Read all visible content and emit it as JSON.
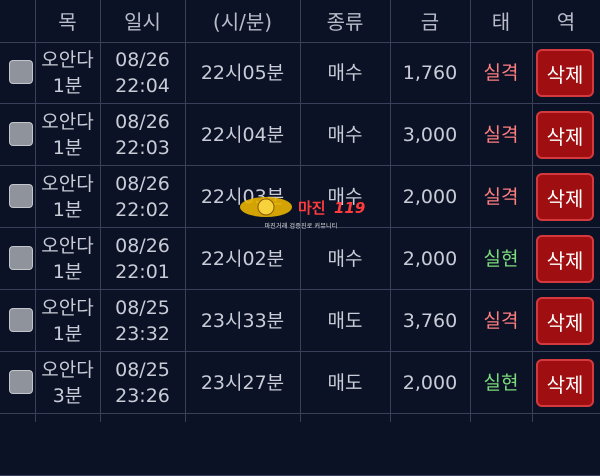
{
  "header": {
    "col1": [
      "",
      "목"
    ],
    "col2": [
      "",
      "일시"
    ],
    "col3": [
      "",
      "(시/분)"
    ],
    "col4": [
      "",
      "종류"
    ],
    "col5": [
      "",
      "금"
    ],
    "col6": [
      "",
      "태"
    ],
    "col7": [
      "",
      "역"
    ]
  },
  "rows": [
    {
      "name_l1": "오안다",
      "name_l2": "1분",
      "date": "08/26",
      "time": "22:04",
      "target": "22시05분",
      "kind": "매수",
      "amount": "1,760",
      "result": "실격",
      "result_status": "fail",
      "delete": "삭제"
    },
    {
      "name_l1": "오안다",
      "name_l2": "1분",
      "date": "08/26",
      "time": "22:03",
      "target": "22시04분",
      "kind": "매수",
      "amount": "3,000",
      "result": "실격",
      "result_status": "fail",
      "delete": "삭제"
    },
    {
      "name_l1": "오안다",
      "name_l2": "1분",
      "date": "08/26",
      "time": "22:02",
      "target": "22시03분",
      "kind": "매수",
      "amount": "2,000",
      "result": "실격",
      "result_status": "fail",
      "delete": "삭제"
    },
    {
      "name_l1": "오안다",
      "name_l2": "1분",
      "date": "08/26",
      "time": "22:01",
      "target": "22시02분",
      "kind": "매수",
      "amount": "2,000",
      "result": "실현",
      "result_status": "ok",
      "delete": "삭제"
    },
    {
      "name_l1": "오안다",
      "name_l2": "1분",
      "date": "08/25",
      "time": "23:32",
      "target": "23시33분",
      "kind": "매도",
      "amount": "3,760",
      "result": "실격",
      "result_status": "fail",
      "delete": "삭제"
    },
    {
      "name_l1": "오안다",
      "name_l2": "3분",
      "date": "08/25",
      "time": "23:26",
      "target": "23시27분",
      "kind": "매도",
      "amount": "2,000",
      "result": "실현",
      "result_status": "ok",
      "delete": "삭제"
    }
  ],
  "watermark": {
    "logo": "마진",
    "logo_num": "119",
    "tagline": "마진거래 검증진로 커뮤니티"
  },
  "colors": {
    "background": "#0b1226",
    "fail": "#ff7f7f",
    "ok": "#7cdc7c",
    "delete_button": "#9f0f12"
  }
}
